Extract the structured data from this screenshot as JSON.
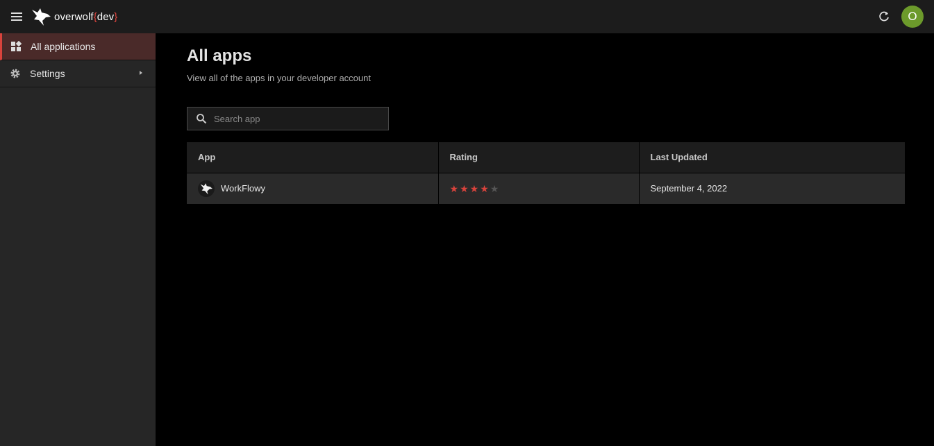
{
  "header": {
    "logo_text": "overwolf",
    "logo_brace_open": "{",
    "logo_dev": "dev",
    "logo_brace_close": "}",
    "avatar_initial": "O",
    "avatar_color": "#6c9a2b",
    "accent_color": "#d9433c"
  },
  "sidebar": {
    "items": [
      {
        "label": "All applications",
        "icon": "grid-icon",
        "active": true
      },
      {
        "label": "Settings",
        "icon": "gear-icon",
        "active": false
      }
    ]
  },
  "main": {
    "title": "All apps",
    "subtitle": "View all of the apps in your developer account",
    "search": {
      "placeholder": "Search app",
      "value": ""
    },
    "table": {
      "columns": [
        "App",
        "Rating",
        "Last Updated"
      ],
      "rows": [
        {
          "app": "WorkFlowy",
          "icon": "wolf-icon",
          "rating": 4,
          "rating_max": 5,
          "last_updated": "September 4, 2022"
        }
      ]
    }
  }
}
